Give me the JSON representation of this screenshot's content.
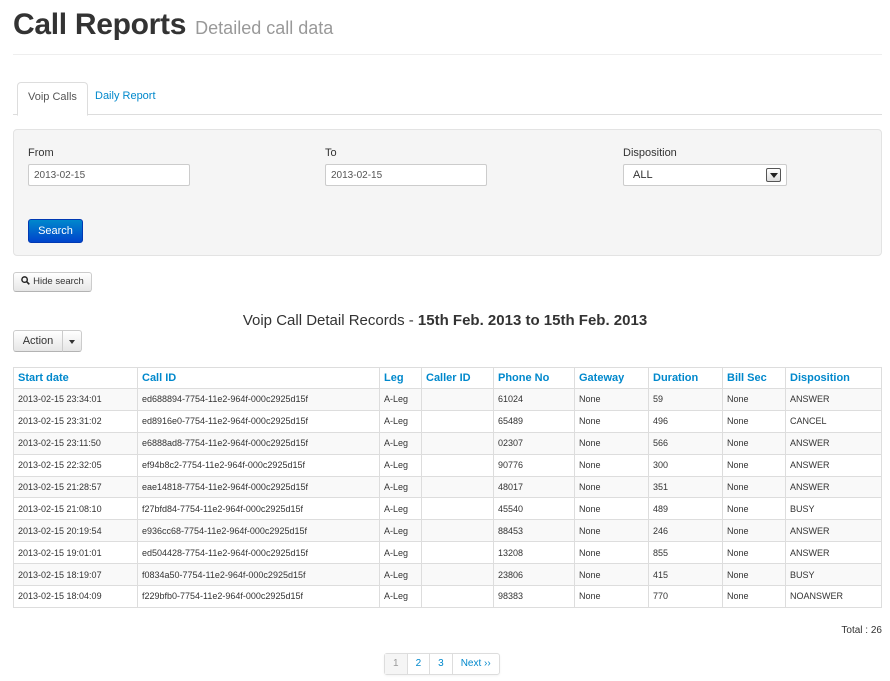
{
  "header": {
    "title": "Call Reports",
    "subtitle": "Detailed call data"
  },
  "tabs": [
    {
      "label": "Voip Calls",
      "active": true
    },
    {
      "label": "Daily Report",
      "active": false
    }
  ],
  "search": {
    "from_label": "From",
    "from_value": "2013-02-15",
    "to_label": "To",
    "to_value": "2013-02-15",
    "disposition_label": "Disposition",
    "disposition_value": "ALL",
    "search_button": "Search"
  },
  "hide_search_label": "Hide search",
  "report": {
    "title_prefix": "Voip Call Detail Records - ",
    "title_range": "15th Feb. 2013 to 15th Feb. 2013"
  },
  "action_label": "Action",
  "table": {
    "columns": [
      "Start date",
      "Call ID",
      "Leg",
      "Caller ID",
      "Phone No",
      "Gateway",
      "Duration",
      "Bill Sec",
      "Disposition"
    ],
    "rows": [
      [
        "2013-02-15 23:34:01",
        "ed688894-7754-11e2-964f-000c2925d15f",
        "A-Leg",
        "",
        "61024",
        "None",
        "59",
        "None",
        "ANSWER"
      ],
      [
        "2013-02-15 23:31:02",
        "ed8916e0-7754-11e2-964f-000c2925d15f",
        "A-Leg",
        "",
        "65489",
        "None",
        "496",
        "None",
        "CANCEL"
      ],
      [
        "2013-02-15 23:11:50",
        "e6888ad8-7754-11e2-964f-000c2925d15f",
        "A-Leg",
        "",
        "02307",
        "None",
        "566",
        "None",
        "ANSWER"
      ],
      [
        "2013-02-15 22:32:05",
        "ef94b8c2-7754-11e2-964f-000c2925d15f",
        "A-Leg",
        "",
        "90776",
        "None",
        "300",
        "None",
        "ANSWER"
      ],
      [
        "2013-02-15 21:28:57",
        "eae14818-7754-11e2-964f-000c2925d15f",
        "A-Leg",
        "",
        "48017",
        "None",
        "351",
        "None",
        "ANSWER"
      ],
      [
        "2013-02-15 21:08:10",
        "f27bfd84-7754-11e2-964f-000c2925d15f",
        "A-Leg",
        "",
        "45540",
        "None",
        "489",
        "None",
        "BUSY"
      ],
      [
        "2013-02-15 20:19:54",
        "e936cc68-7754-11e2-964f-000c2925d15f",
        "A-Leg",
        "",
        "88453",
        "None",
        "246",
        "None",
        "ANSWER"
      ],
      [
        "2013-02-15 19:01:01",
        "ed504428-7754-11e2-964f-000c2925d15f",
        "A-Leg",
        "",
        "13208",
        "None",
        "855",
        "None",
        "ANSWER"
      ],
      [
        "2013-02-15 18:19:07",
        "f0834a50-7754-11e2-964f-000c2925d15f",
        "A-Leg",
        "",
        "23806",
        "None",
        "415",
        "None",
        "BUSY"
      ],
      [
        "2013-02-15 18:04:09",
        "f229bfb0-7754-11e2-964f-000c2925d15f",
        "A-Leg",
        "",
        "98383",
        "None",
        "770",
        "None",
        "NOANSWER"
      ]
    ]
  },
  "total_label": "Total : 26",
  "pagination": {
    "pages": [
      "1",
      "2",
      "3"
    ],
    "current": "1",
    "next_label": "Next ››"
  },
  "colors": {
    "link": "#0088cc",
    "primary_button": "#0044cc"
  }
}
